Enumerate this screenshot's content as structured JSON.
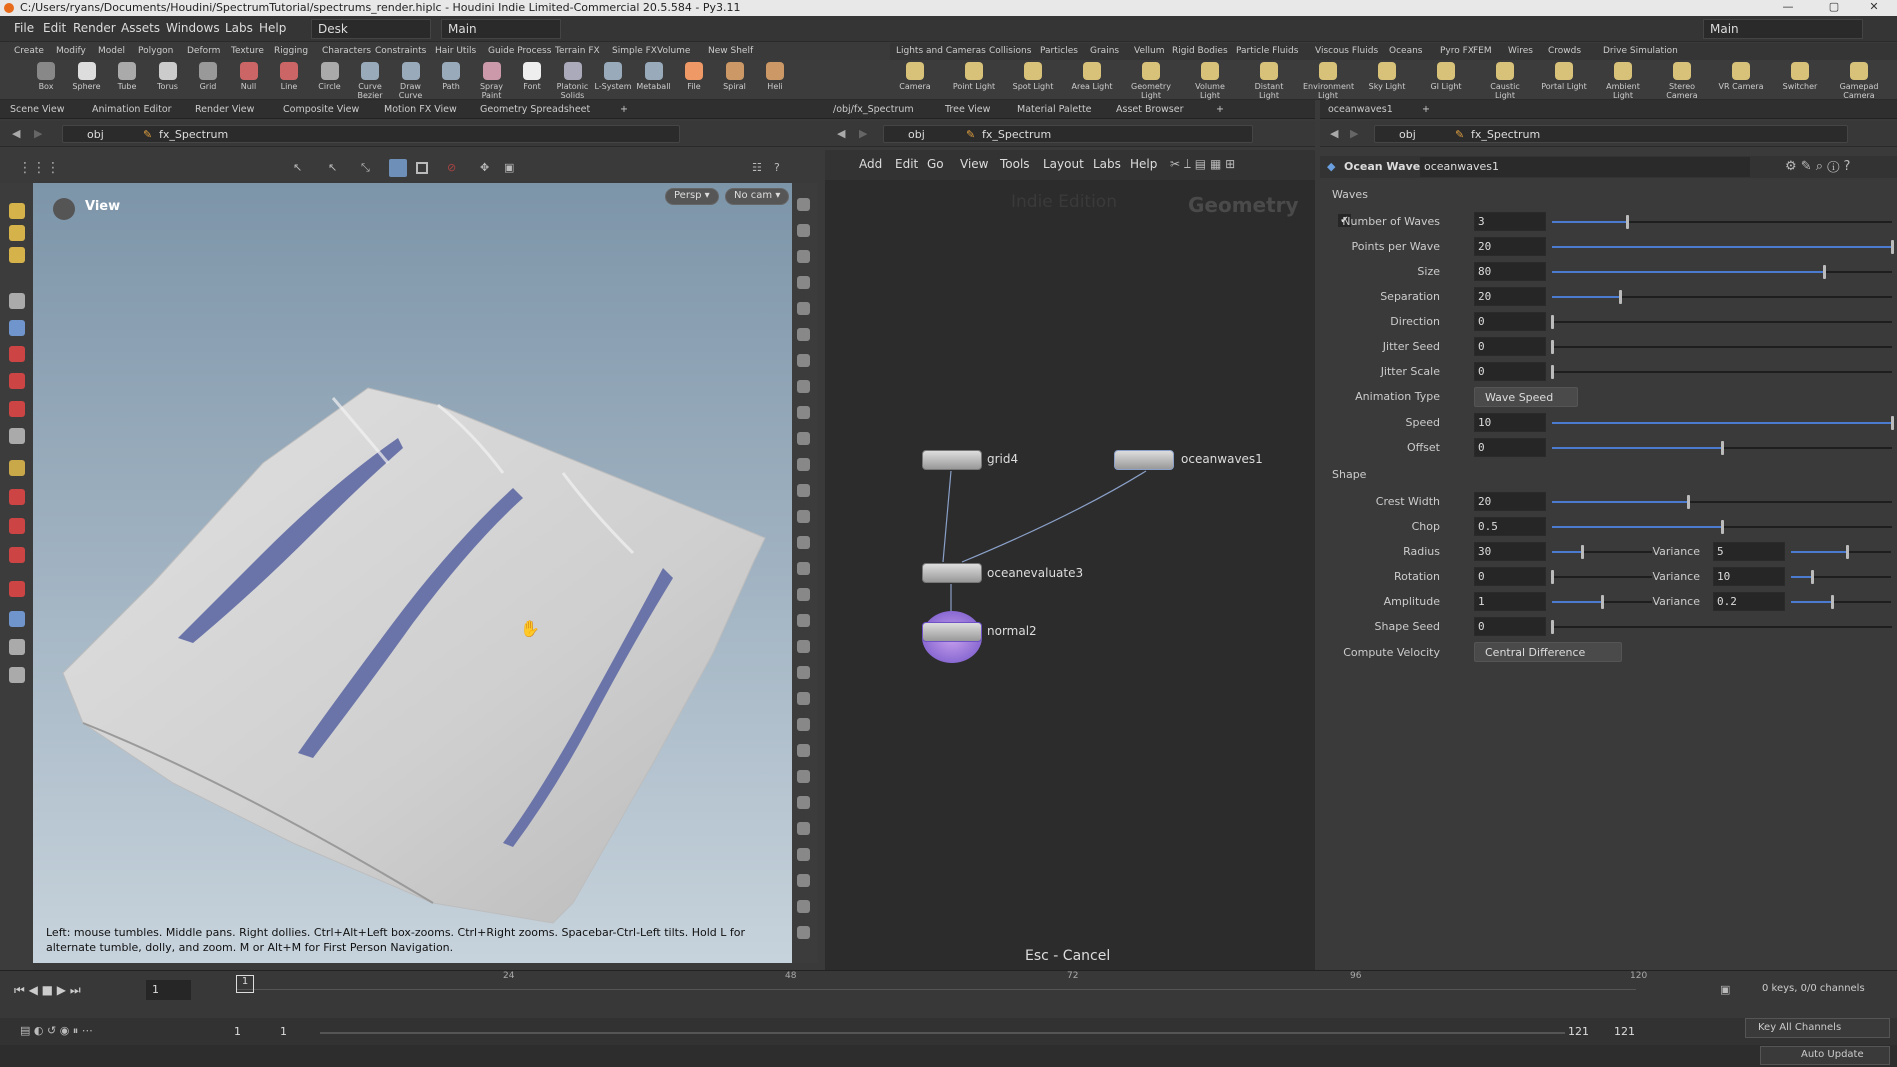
{
  "window": {
    "title": "C:/Users/ryans/Documents/Houdini/SpectrumTutorial/spectrums_render.hiplc - Houdini Indie Limited-Commercial 20.5.584 - Py3.11",
    "controls": [
      "—",
      "▢",
      "✕"
    ]
  },
  "menu": {
    "items": [
      "File",
      "Edit",
      "Render",
      "Assets",
      "Windows",
      "Labs",
      "Help"
    ],
    "desk": "Desk",
    "main": "Main",
    "right_main": "Main"
  },
  "shelf_tabs_left": [
    "Create",
    "Modify",
    "Model",
    "Polygon",
    "Deform",
    "Texture",
    "Rigging",
    "Characters",
    "Constraints",
    "Hair Utils",
    "Guide Process",
    "Terrain FX",
    "Simple FX",
    "Volume",
    "New Shelf"
  ],
  "shelf_tabs_right": [
    "Lights and Cameras",
    "Collisions",
    "Particles",
    "Grains",
    "Vellum",
    "Rigid Bodies",
    "Particle Fluids",
    "Viscous Fluids",
    "Oceans",
    "Pyro FX",
    "FEM",
    "Wires",
    "Crowds",
    "Drive Simulation"
  ],
  "tools_left": [
    "Box",
    "Sphere",
    "Tube",
    "Torus",
    "Grid",
    "Null",
    "Line",
    "Circle",
    "Curve Bezier",
    "Draw Curve",
    "Path",
    "Spray Paint",
    "Font",
    "Platonic Solids",
    "L-System",
    "Metaball",
    "File",
    "Spiral",
    "Heli"
  ],
  "tools_right": [
    "Camera",
    "Point Light",
    "Spot Light",
    "Area Light",
    "Geometry Light",
    "Volume Light",
    "Distant Light",
    "Environment Light",
    "Sky Light",
    "GI Light",
    "Caustic Light",
    "Portal Light",
    "Ambient Light",
    "Stereo Camera",
    "VR Camera",
    "Switcher",
    "Gamepad Camera"
  ],
  "left_pane_tabs": [
    "Scene View",
    "Animation Editor",
    "Render View",
    "Composite View",
    "Motion FX View",
    "Geometry Spreadsheet"
  ],
  "mid_pane_tabs": [
    "/obj/fx_Spectrum",
    "Tree View",
    "Material Palette",
    "Asset Browser"
  ],
  "right_pane_tabs": [
    "oceanwaves1"
  ],
  "path": {
    "obj": "obj",
    "node": "fx_Spectrum"
  },
  "viewport": {
    "label": "View",
    "persp": "Persp ▾",
    "cam": "No cam ▾",
    "hint": "Left: mouse tumbles. Middle pans. Right dollies. Ctrl+Alt+Left box-zooms. Ctrl+Right zooms. Spacebar-Ctrl-Left tilts. Hold L for alternate tumble, dolly, and zoom. M or Alt+M for First Person Navigation."
  },
  "network": {
    "menu": [
      "Add",
      "Edit",
      "Go",
      "View",
      "Tools",
      "Layout",
      "Labs",
      "Help"
    ],
    "watermark": "Indie Edition",
    "context": "Geometry",
    "nodes": [
      "grid4",
      "oceanwaves1",
      "oceanevaluate3",
      "normal2"
    ],
    "footer": "Esc - Cancel"
  },
  "parms": {
    "node_type": "Ocean Waves",
    "node_name": "oceanwaves1",
    "waves_section": "Waves",
    "shape_section": "Shape",
    "waves": [
      {
        "label": "Number of Waves",
        "value": "3",
        "pos": 0.22
      },
      {
        "label": "Points per Wave",
        "value": "20",
        "pos": 1.0
      },
      {
        "label": "Size",
        "value": "80",
        "pos": 0.8
      },
      {
        "label": "Separation",
        "value": "20",
        "pos": 0.2
      },
      {
        "label": "Direction",
        "value": "0",
        "pos": 0.0
      },
      {
        "label": "Jitter Seed",
        "value": "0",
        "pos": 0.0
      },
      {
        "label": "Jitter Scale",
        "value": "0",
        "pos": 0.0
      }
    ],
    "anim_type_label": "Animation Type",
    "anim_type_value": "Wave Speed",
    "anim": [
      {
        "label": "Speed",
        "value": "10",
        "pos": 1.0
      },
      {
        "label": "Offset",
        "value": "0",
        "pos": 0.5
      }
    ],
    "shape": [
      {
        "label": "Crest Width",
        "value": "20",
        "pos": 0.4,
        "var": null
      },
      {
        "label": "Chop",
        "value": "0.5",
        "pos": 0.5,
        "var": null
      },
      {
        "label": "Radius",
        "value": "30",
        "pos": 0.3,
        "var": {
          "label": "Variance",
          "value": "5",
          "pos": 0.55
        }
      },
      {
        "label": "Rotation",
        "value": "0",
        "pos": 0.0,
        "var": {
          "label": "Variance",
          "value": "10",
          "pos": 0.2
        }
      },
      {
        "label": "Amplitude",
        "value": "1",
        "pos": 0.5,
        "var": {
          "label": "Variance",
          "value": "0.2",
          "pos": 0.4
        }
      },
      {
        "label": "Shape Seed",
        "value": "0",
        "pos": 0.0,
        "var": null
      }
    ],
    "velocity_label": "Compute Velocity",
    "velocity_value": "Central Difference"
  },
  "timeline": {
    "frame": "1",
    "ticks": [
      "24",
      "48",
      "72",
      "96",
      "120"
    ],
    "start": "1",
    "start2": "1",
    "end": "121",
    "end2": "121",
    "keys": "0 keys, 0/0 channels",
    "key_all": "Key All Channels",
    "auto_update": "Auto Update"
  },
  "colors": {
    "accent": "#4a7bd0",
    "surface": "#d6d6d6",
    "troughs": "#6b74a8"
  }
}
